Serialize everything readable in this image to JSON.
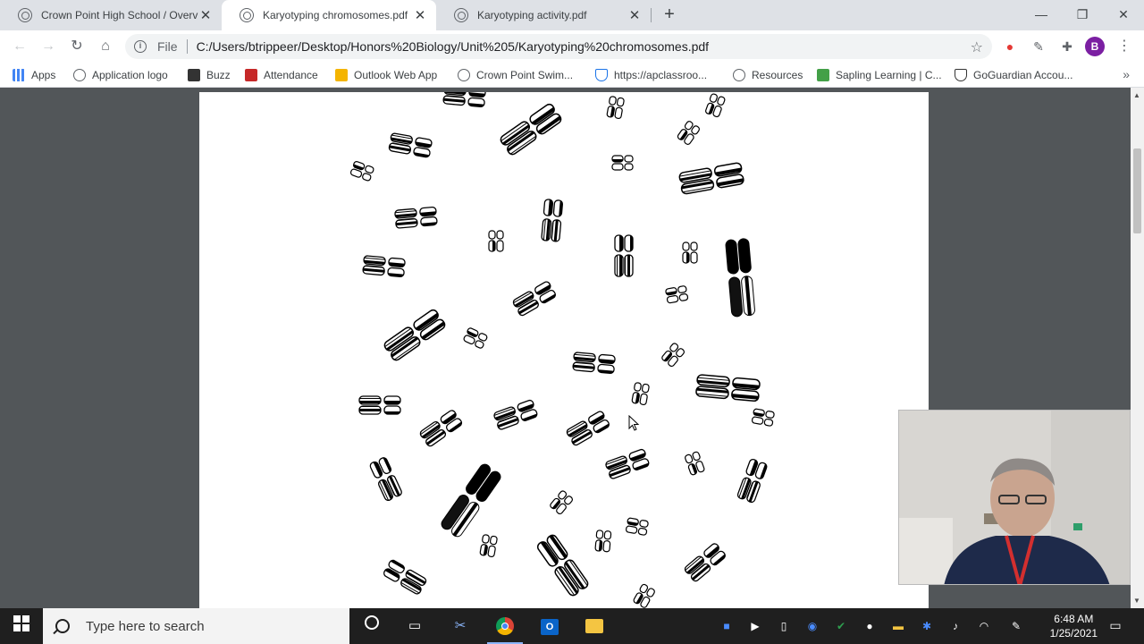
{
  "tabs": [
    {
      "title": "Crown Point High School / Overv",
      "close": "✕"
    },
    {
      "title": "Karyotyping chromosomes.pdf",
      "close": "✕"
    },
    {
      "title": "Karyotyping activity.pdf",
      "close": "✕"
    }
  ],
  "new_tab": "+",
  "window_controls": {
    "minimize": "—",
    "restore": "❐",
    "close": "✕"
  },
  "toolbar": {
    "back": "←",
    "forward": "→",
    "reload": "↻",
    "home": "⌂",
    "scheme": "File",
    "url": "C:/Users/btrippeer/Desktop/Honors%20Biology/Unit%205/Karyotyping%20chromosomes.pdf",
    "profile_initial": "B",
    "menu": "⋮"
  },
  "bookmarks": [
    {
      "label": "Apps",
      "icon": "apps-grid-icon",
      "color": "#4285f4"
    },
    {
      "label": "Application logo",
      "icon": "globe-icon",
      "color": "#5f6368"
    },
    {
      "label": "Buzz",
      "icon": "buzz-icon",
      "color": "#333333"
    },
    {
      "label": "Attendance",
      "icon": "sm-icon",
      "color": "#c62828"
    },
    {
      "label": "Outlook Web App",
      "icon": "outlook-icon",
      "color": "#f4b400"
    },
    {
      "label": "Crown Point Swim...",
      "icon": "globe-icon",
      "color": "#5f6368"
    },
    {
      "label": "https://apclassroo...",
      "icon": "shield-icon",
      "color": "#1a73e8"
    },
    {
      "label": "Resources",
      "icon": "globe-icon",
      "color": "#5f6368"
    },
    {
      "label": "Sapling Learning | C...",
      "icon": "sapling-icon",
      "color": "#43a047"
    },
    {
      "label": "GoGuardian Accou...",
      "icon": "goguardian-icon",
      "color": "#333333"
    }
  ],
  "bookmarks_more": "»",
  "taskbar": {
    "search_placeholder": "Type here to search",
    "time": "6:48 AM",
    "date": "1/25/2021"
  },
  "colors": {
    "accent": "#1a73e8",
    "profile": "#7b1fa2",
    "viewer_bg": "#525659",
    "taskbar_bg": "#1f1f1f"
  }
}
